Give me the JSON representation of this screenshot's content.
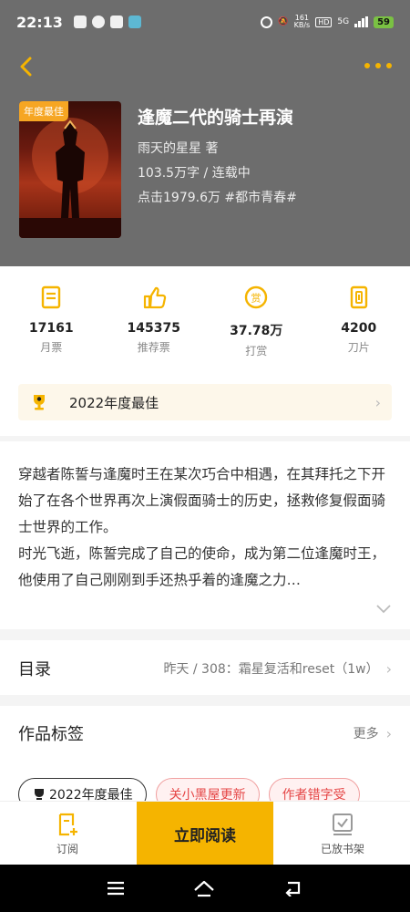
{
  "status_bar": {
    "time": "22:13",
    "speed_value": "161",
    "speed_unit": "KB/s",
    "hd": "HD",
    "network": "5G",
    "battery": "59"
  },
  "book": {
    "badge": "年度最佳",
    "title": "逢魔二代的骑士再演",
    "author": "雨天的星星  著",
    "words_status": "103.5万字 / 连载中",
    "clicks_genre": "点击1979.6万  #都市青春#"
  },
  "stats": [
    {
      "value": "17161",
      "label": "月票",
      "icon": "monthly-ticket-icon"
    },
    {
      "value": "145375",
      "label": "推荐票",
      "icon": "thumbs-up-icon"
    },
    {
      "value": "37.78万",
      "label": "打赏",
      "icon": "reward-coin-icon"
    },
    {
      "value": "4200",
      "label": "刀片",
      "icon": "blade-icon"
    }
  ],
  "award": {
    "label": "2022年度最佳",
    "icon": "trophy-icon"
  },
  "synopsis": {
    "p1": "穿越者陈誓与逢魔时王在某次巧合中相遇，在其拜托之下开始了在各个世界再次上演假面骑士的历史，拯救修复假面骑士世界的工作。",
    "p2": "时光飞逝，陈誓完成了自己的使命，成为第二位逢魔时王，他使用了自己刚刚到手还热乎着的逢魔之力…"
  },
  "catalog": {
    "heading": "目录",
    "latest": "昨天 / 308：霜星复活和reset（1w）"
  },
  "work_tags": {
    "heading": "作品标签",
    "more": "更多",
    "items": [
      "2022年度最佳",
      "关小黑屋更新",
      "作者错字受"
    ]
  },
  "actions": {
    "subscribe": "订阅",
    "read_now": "立即阅读",
    "on_shelf": "已放书架"
  },
  "colors": {
    "accent": "#f5b400",
    "header_bg": "#6d6d6d",
    "tag_red": "#e54545"
  }
}
